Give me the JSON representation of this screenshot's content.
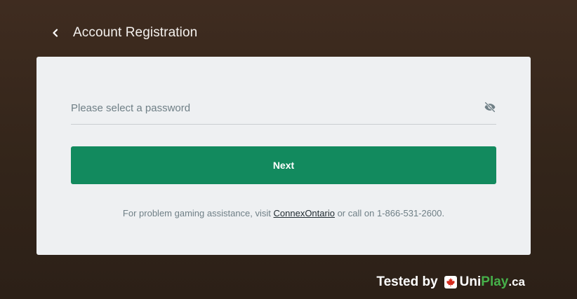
{
  "header": {
    "title": "Account Registration",
    "back_icon": "chevron-left-icon"
  },
  "form": {
    "password_placeholder": "Please select a password",
    "password_value": "",
    "visibility_icon": "eye-off-icon",
    "next_label": "Next"
  },
  "help": {
    "prefix": "For problem gaming assistance, visit ",
    "link_text": "ConnexOntario",
    "suffix": " or call on 1-866-531-2600."
  },
  "footer": {
    "tested_label": "Tested by",
    "brand_uni": "Uni",
    "brand_play": "Play",
    "brand_tld": ".ca",
    "brand_icon": "maple-leaf-icon"
  },
  "colors": {
    "background": "#3a2a1f",
    "card": "#eef0f2",
    "primary_button": "#128a5e",
    "brand_green": "#46b04a",
    "maple_red": "#d52b1e"
  }
}
